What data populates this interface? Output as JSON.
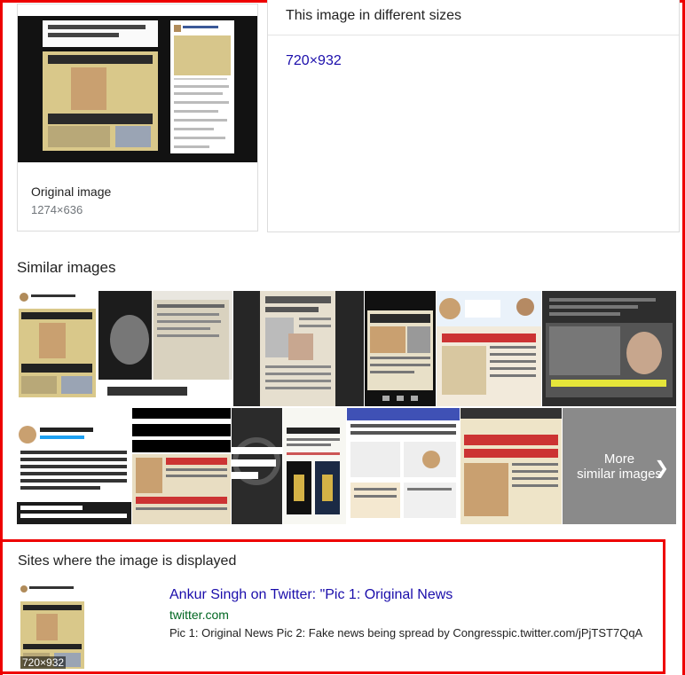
{
  "original": {
    "label": "Original image",
    "size": "1274×636"
  },
  "sizes": {
    "title": "This image in different sizes",
    "link": "720×932"
  },
  "similar": {
    "title": "Similar images",
    "more_line1": "More",
    "more_line2": "similar images"
  },
  "sites": {
    "title": "Sites where the image is displayed",
    "result": {
      "thumb_size": "720×932",
      "link": "Ankur Singh on Twitter: \"Pic 1: Original News",
      "domain": "twitter.com",
      "description": "Pic 1: Original News Pic 2: Fake news being spread by Congresspic.twitter.com/jPjTST7QqA"
    }
  },
  "colors": {
    "link": "#1a0dab",
    "domain": "#006621",
    "highlight": "#ee0000"
  }
}
